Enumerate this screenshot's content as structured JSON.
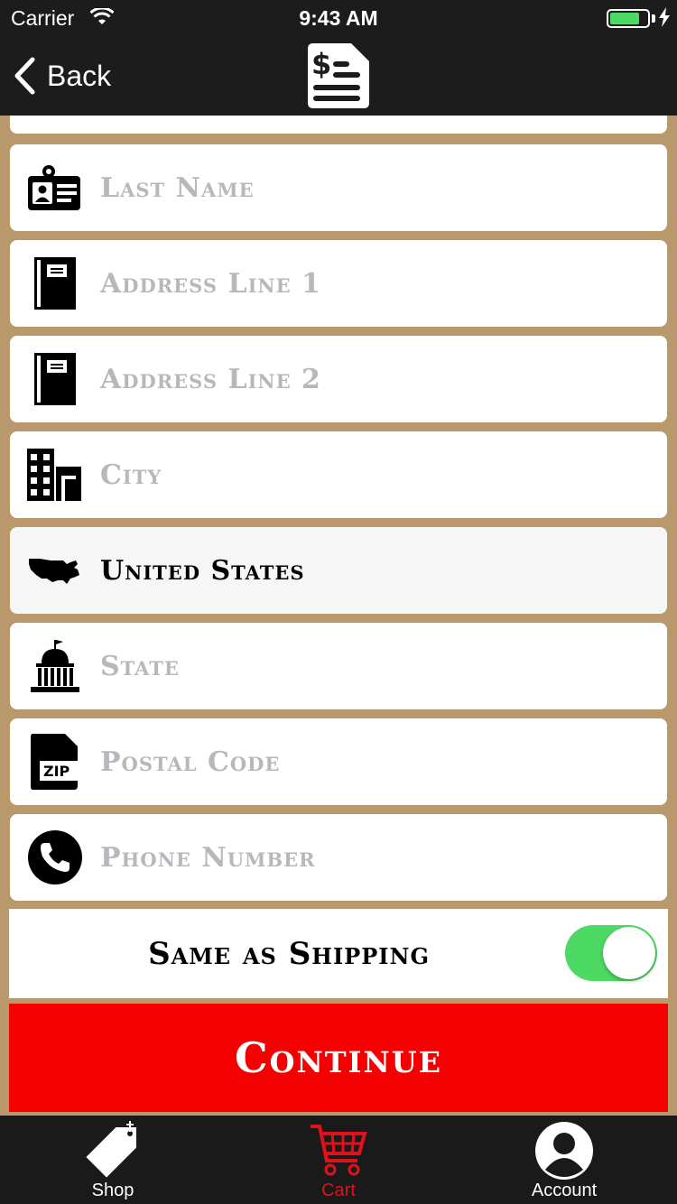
{
  "status_bar": {
    "carrier": "Carrier",
    "time": "9:43 AM",
    "battery_level": 0.8
  },
  "nav": {
    "back_label": "Back",
    "icon": "receipt-dollar-icon"
  },
  "fields": {
    "last_name": {
      "placeholder": "Last Name",
      "icon": "id-card-icon"
    },
    "address1": {
      "placeholder": "Address Line 1",
      "icon": "address-book-icon"
    },
    "address2": {
      "placeholder": "Address Line 2",
      "icon": "address-book-icon"
    },
    "city": {
      "placeholder": "City",
      "icon": "city-buildings-icon"
    },
    "country": {
      "value": "United States",
      "icon": "usa-map-icon"
    },
    "state": {
      "placeholder": "State",
      "icon": "capitol-building-icon"
    },
    "postal": {
      "placeholder": "Postal Code",
      "icon": "zip-file-icon"
    },
    "phone": {
      "placeholder": "Phone Number",
      "icon": "phone-icon"
    }
  },
  "same_as_shipping": {
    "label": "Same as Shipping",
    "enabled": true
  },
  "continue_label": "Continue",
  "tabs": [
    {
      "label": "Shop",
      "icon": "price-tag-icon",
      "active": false
    },
    {
      "label": "Cart",
      "icon": "cart-icon",
      "active": true
    },
    {
      "label": "Account",
      "icon": "user-circle-icon",
      "active": false
    }
  ],
  "colors": {
    "background": "#b9996b",
    "bar": "#1c1c1c",
    "accent_red": "#f50000",
    "toggle_on": "#4cd964",
    "placeholder": "#b8b8bc"
  }
}
